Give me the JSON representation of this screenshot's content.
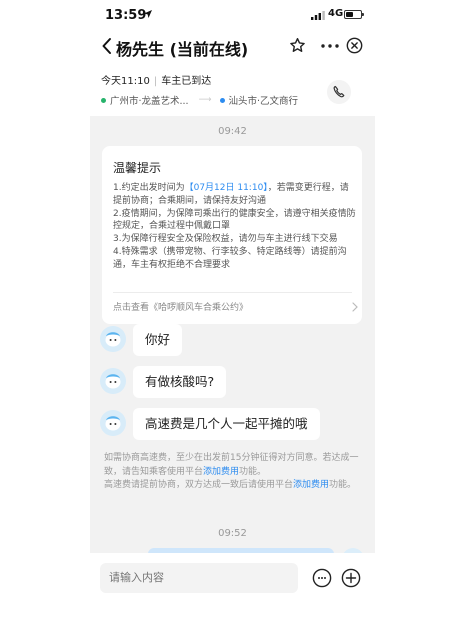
{
  "status_bar": {
    "time": "13:59",
    "network": "4G"
  },
  "nav": {
    "title": "杨先生 (当前在线)"
  },
  "trip": {
    "time": "今天11:10",
    "status": "车主已到达",
    "origin": "广州市·龙盖艺术...",
    "destination": "汕头市·乙文商行"
  },
  "chat": {
    "timestamp_1": "09:42",
    "notice": {
      "title": "温馨提示",
      "line1_prefix": "1.约定出发时间为",
      "line1_highlight": "【07月12日 11:10】",
      "line1_suffix": "，若需变更行程，请提前协商；合乘期间，请保持友好沟通",
      "line2": "2.疫情期间，为保障司乘出行的健康安全，请遵守相关疫情防控规定，合乘过程中佩戴口罩",
      "line3": "3.为保障行程安全及保险权益，请勿与车主进行线下交易",
      "line4": "4.特殊需求（携带宠物、行李较多、特定路线等）请提前沟通，车主有权拒绝不合理要求",
      "link": "点击查看《哈啰顺风车合乘公约》"
    },
    "messages": [
      {
        "text": "你好"
      },
      {
        "text": "有做核酸吗?"
      },
      {
        "text": "高速费是几个人一起平摊的哦"
      }
    ],
    "system_note": {
      "part1": "如需协商高速费，至少在出发前15分钟征得对方同意。若达成一致，请告知乘客使用平台",
      "link1": "添加费用",
      "part2": "功能。",
      "part3": "高速费请提前协商，双方达成一致后请使用平台",
      "link2": "添加费用",
      "part4": "功能。"
    },
    "timestamp_2": "09:52"
  },
  "input": {
    "placeholder": "请输入内容"
  },
  "colors": {
    "accent": "#2d8cf0",
    "chat_background": "#f2f2f2",
    "origin_dot": "#26b36b",
    "destination_dot": "#2d8cf0"
  }
}
